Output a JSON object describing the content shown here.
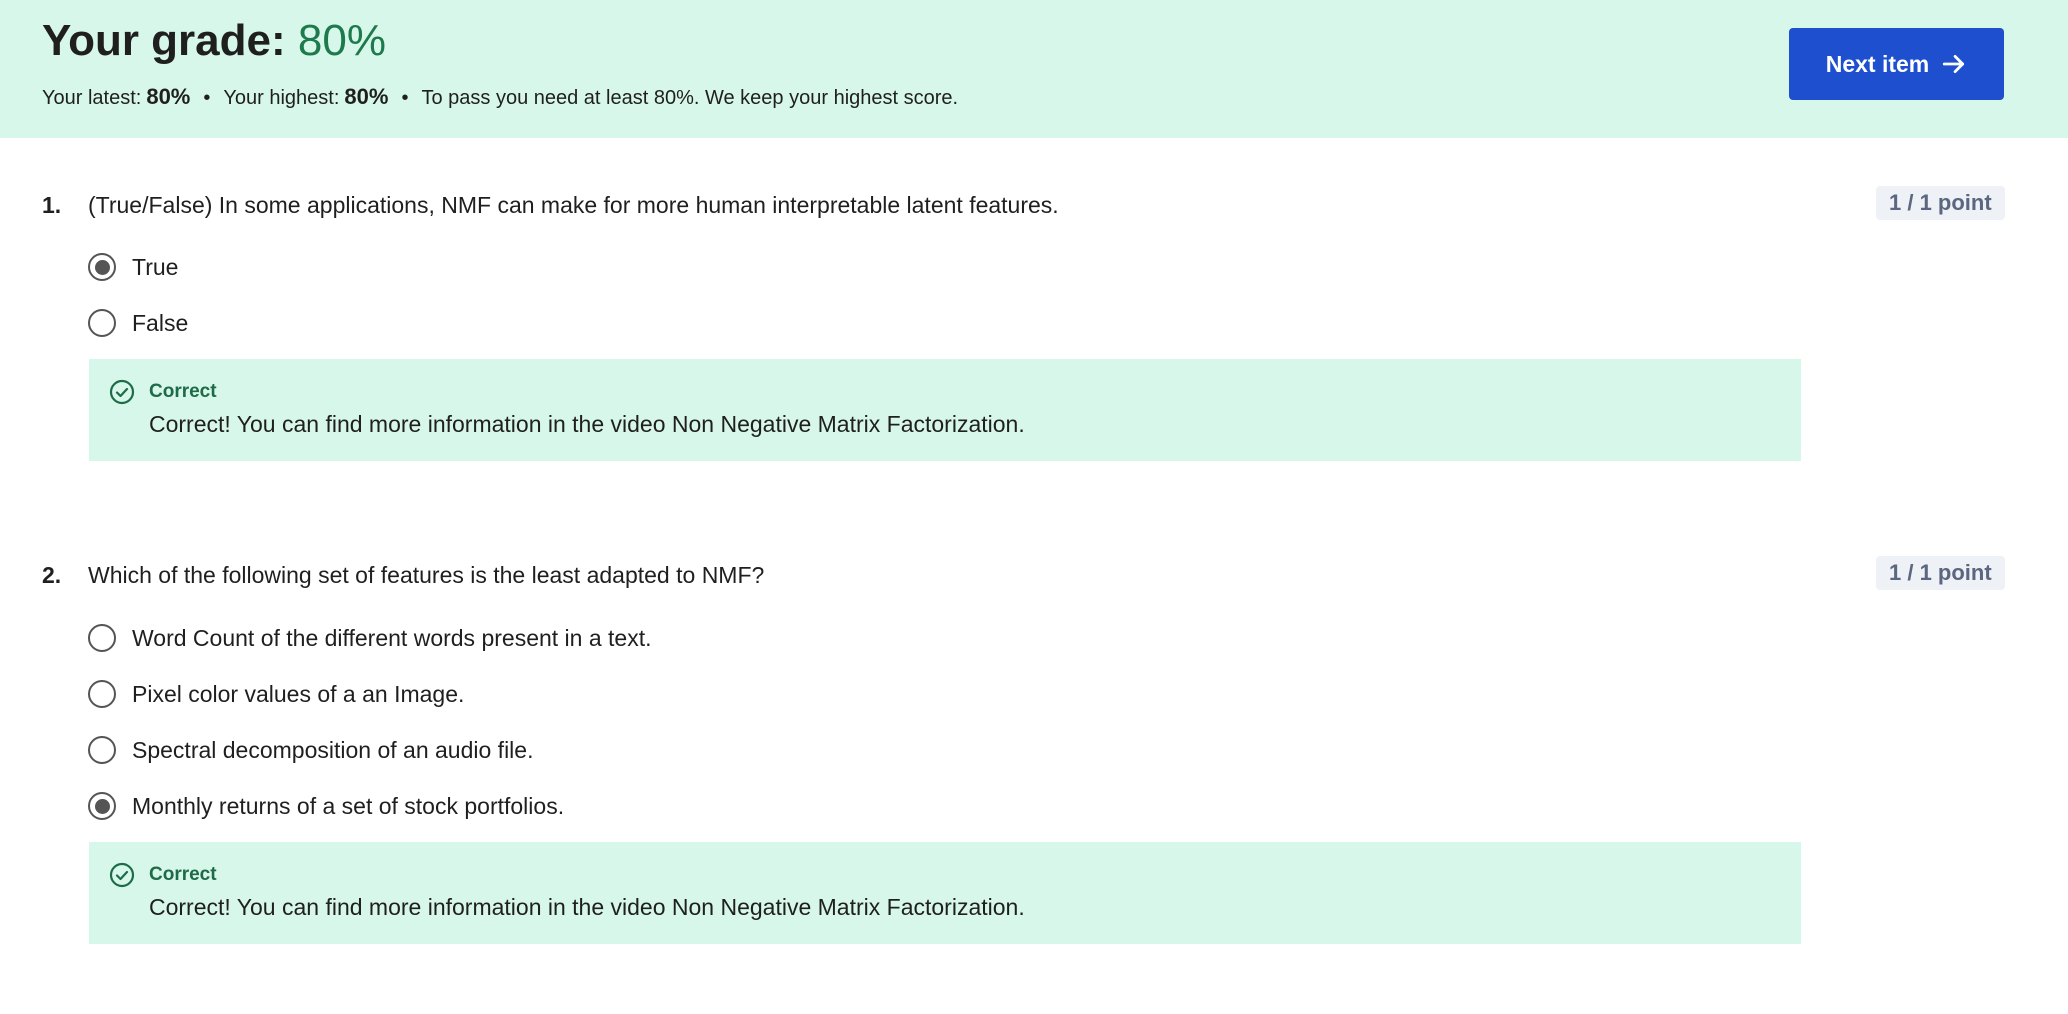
{
  "header": {
    "grade_label": "Your grade:",
    "grade_value": "80%",
    "latest_label": "Your latest:",
    "latest_value": "80%",
    "highest_label": "Your highest:",
    "highest_value": "80%",
    "separator": "•",
    "pass_note": "To pass you need at least 80%. We keep your highest score.",
    "next_button_label": "Next item",
    "next_button_icon": "arrow-right-icon"
  },
  "questions": [
    {
      "number": "1.",
      "text": "(True/False) In some applications, NMF can make for more human interpretable latent features.",
      "points": "1 / 1 point",
      "options": [
        {
          "label": "True",
          "selected": true
        },
        {
          "label": "False",
          "selected": false
        }
      ],
      "feedback": {
        "icon": "check-circle-icon",
        "title": "Correct",
        "text": "Correct! You can find more information in the video Non Negative Matrix Factorization."
      }
    },
    {
      "number": "2.",
      "text": "Which of the following set of features is the least adapted to NMF?",
      "points": "1 / 1 point",
      "options": [
        {
          "label": "Word Count of the different words present in a text.",
          "selected": false
        },
        {
          "label": "Pixel color values of a an Image.",
          "selected": false
        },
        {
          "label": "Spectral decomposition of an audio file.",
          "selected": false
        },
        {
          "label": "Monthly returns of a set of stock portfolios.",
          "selected": true
        }
      ],
      "feedback": {
        "icon": "check-circle-icon",
        "title": "Correct",
        "text": "Correct! You can find more information in the video Non Negative Matrix Factorization."
      }
    }
  ],
  "colors": {
    "banner_bg": "#d7f7ea",
    "grade_green": "#1e7a4d",
    "primary_button": "#1d4fcf",
    "feedback_bg": "#d7f7ea",
    "points_badge_bg": "#eef1f6"
  }
}
